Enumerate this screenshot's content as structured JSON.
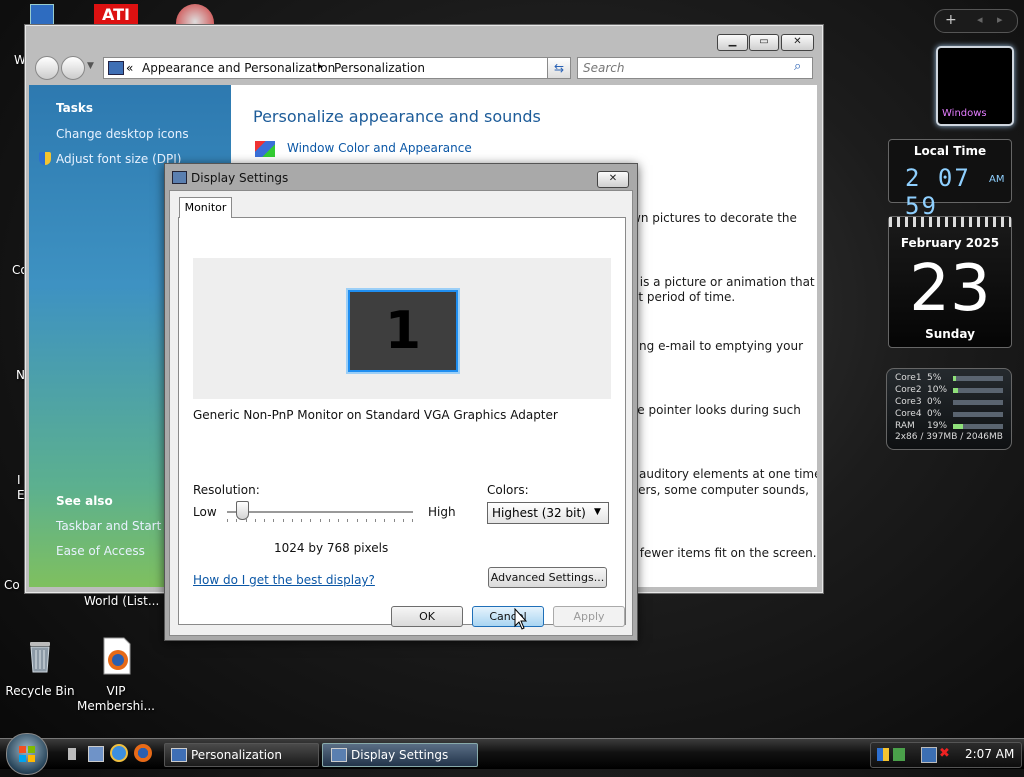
{
  "desktop": {
    "icons": [
      {
        "label": "Recycle Bin"
      },
      {
        "label": "VIP Membershi..."
      }
    ],
    "partial_text": {
      "left_w": "W",
      "left_co1": "Co",
      "left_n": "N",
      "left_i": "I",
      "left_e": "E",
      "left_co2": "Co",
      "world": "World (List..."
    },
    "top_icon_labels": [
      "ATI"
    ]
  },
  "explorer": {
    "breadcrumb": {
      "chevrons": "«",
      "parent": "Appearance and Personalization",
      "separator": "▸",
      "current": "Personalization"
    },
    "search_placeholder": "Search",
    "tasks": {
      "heading": "Tasks",
      "links": [
        "Change desktop icons",
        "Adjust font size (DPI)"
      ]
    },
    "see_also": {
      "heading": "See also",
      "links": [
        "Taskbar and Start M",
        "Ease of Access"
      ]
    },
    "content": {
      "title": "Personalize appearance and sounds",
      "first_link": "Window Color and Appearance",
      "desc_lines": [
        "wn pictures to decorate the",
        "r is a picture or animation that",
        "et period of time.",
        "ting e-mail to emptying your",
        "se pointer looks during such",
        "auditory elements at one time",
        "vers, some computer sounds,",
        "r fewer items fit on the screen."
      ]
    }
  },
  "dialog": {
    "title": "Display Settings",
    "tab": "Monitor",
    "monitor_number": "1",
    "monitor_name": "Generic Non-PnP Monitor on Standard VGA Graphics Adapter",
    "resolution_label": "Resolution:",
    "low_label": "Low",
    "high_label": "High",
    "resolution_value": "1024 by 768 pixels",
    "resolution_slider_position": 0.05,
    "colors_label": "Colors:",
    "colors_value": "Highest (32 bit)",
    "help_link": "How do I get the best display?",
    "advanced_button": "Advanced Settings...",
    "ok_button": "OK",
    "cancel_button": "Cancel",
    "apply_button": "Apply"
  },
  "gadgets": {
    "preview_label": "Windows",
    "clock": {
      "title": "Local Time",
      "hours": "2",
      "minutes": "07",
      "seconds": "59",
      "ampm": "AM"
    },
    "calendar": {
      "month_year": "February 2025",
      "day": "23",
      "weekday": "Sunday"
    },
    "cpu": {
      "rows": [
        {
          "label": "Core1",
          "value": "5%",
          "fill": 0.05
        },
        {
          "label": "Core2",
          "value": "10%",
          "fill": 0.1
        },
        {
          "label": "Core3",
          "value": "0%",
          "fill": 0.0
        },
        {
          "label": "Core4",
          "value": "0%",
          "fill": 0.0
        },
        {
          "label": "RAM",
          "value": "19%",
          "fill": 0.19
        }
      ],
      "footer": "2x86 / 397MB / 2046MB"
    },
    "sidebar_controls": [
      "+",
      "◂",
      "▸"
    ]
  },
  "taskbar": {
    "tasks": [
      "Personalization",
      "Display Settings"
    ],
    "clock": "2:07 AM"
  },
  "colors": {
    "accent_blue": "#1f8ef0",
    "link_blue": "#0b57a6",
    "title_blue": "#1d5c99"
  }
}
